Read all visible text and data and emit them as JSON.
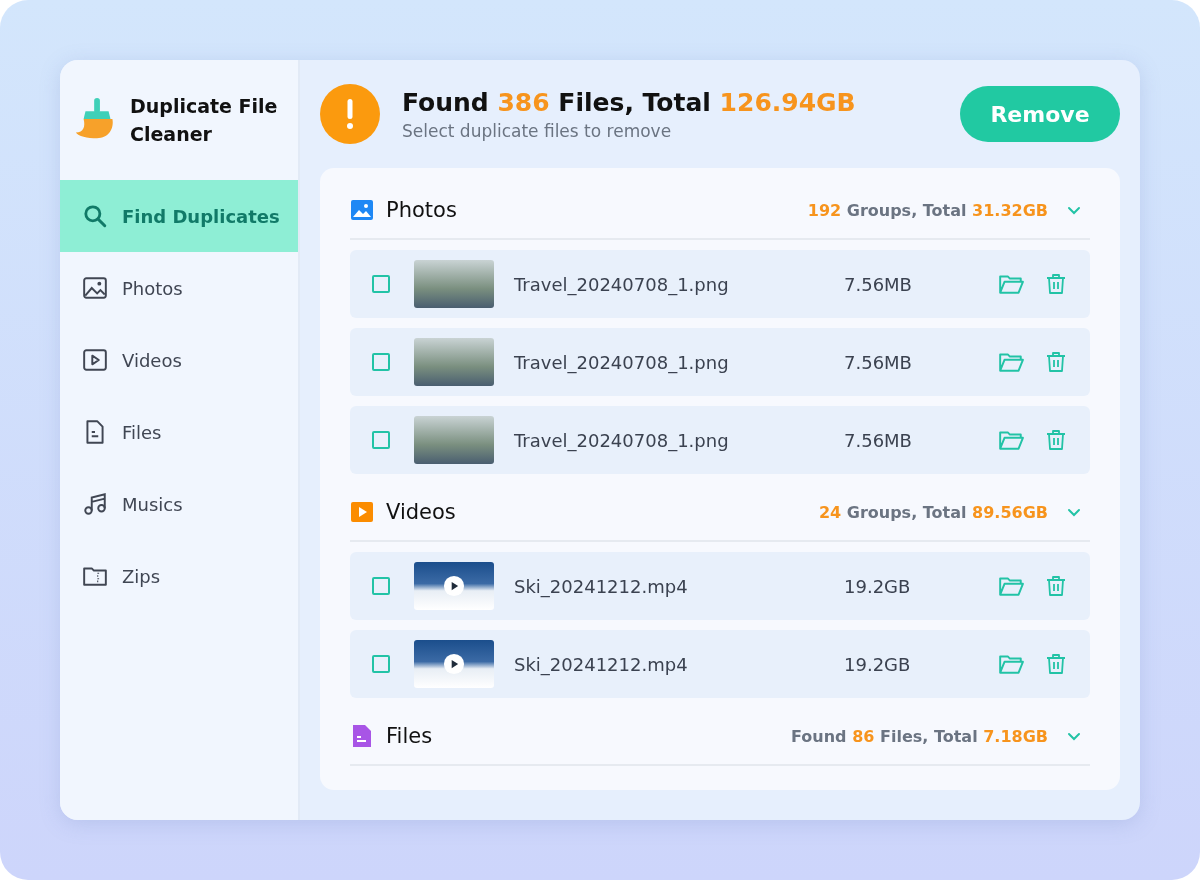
{
  "app": {
    "name": "Duplicate File Cleaner"
  },
  "sidebar": {
    "items": [
      {
        "label": "Find Duplicates",
        "kind": "search",
        "selected": true
      },
      {
        "label": "Photos",
        "kind": "photo",
        "selected": false
      },
      {
        "label": "Videos",
        "kind": "video",
        "selected": false
      },
      {
        "label": "Files",
        "kind": "file",
        "selected": false
      },
      {
        "label": "Musics",
        "kind": "music",
        "selected": false
      },
      {
        "label": "Zips",
        "kind": "zip",
        "selected": false
      }
    ]
  },
  "header": {
    "title": [
      {
        "text": "Found ",
        "highlight": false
      },
      {
        "text": "386",
        "highlight": true
      },
      {
        "text": " Files, Total ",
        "highlight": false
      },
      {
        "text": "126.94GB",
        "highlight": true
      }
    ],
    "subtitle": "Select duplicate files to remove",
    "button": "Remove"
  },
  "sections": [
    {
      "kind": "photos",
      "title": "Photos",
      "summary": [
        {
          "text": "192",
          "highlight": true
        },
        {
          "text": " Groups, Total ",
          "highlight": false
        },
        {
          "text": "31.32GB",
          "highlight": true
        }
      ],
      "rows": [
        {
          "kind": "photo",
          "name": "Travel_20240708_1.png",
          "size": "7.56MB",
          "checked": false
        },
        {
          "kind": "photo",
          "name": "Travel_20240708_1.png",
          "size": "7.56MB",
          "checked": false
        },
        {
          "kind": "photo",
          "name": "Travel_20240708_1.png",
          "size": "7.56MB",
          "checked": false
        }
      ]
    },
    {
      "kind": "videos",
      "title": "Videos",
      "summary": [
        {
          "text": "24",
          "highlight": true
        },
        {
          "text": " Groups, Total ",
          "highlight": false
        },
        {
          "text": "89.56GB",
          "highlight": true
        }
      ],
      "rows": [
        {
          "kind": "video",
          "name": "Ski_20241212.mp4",
          "size": "19.2GB",
          "checked": false
        },
        {
          "kind": "video",
          "name": "Ski_20241212.mp4",
          "size": "19.2GB",
          "checked": false
        }
      ]
    },
    {
      "kind": "files",
      "title": "Files",
      "summary": [
        {
          "text": "Found ",
          "highlight": false
        },
        {
          "text": "86",
          "highlight": true
        },
        {
          "text": " Files, Total ",
          "highlight": false
        },
        {
          "text": "7.18GB",
          "highlight": true
        }
      ]
    }
  ]
}
